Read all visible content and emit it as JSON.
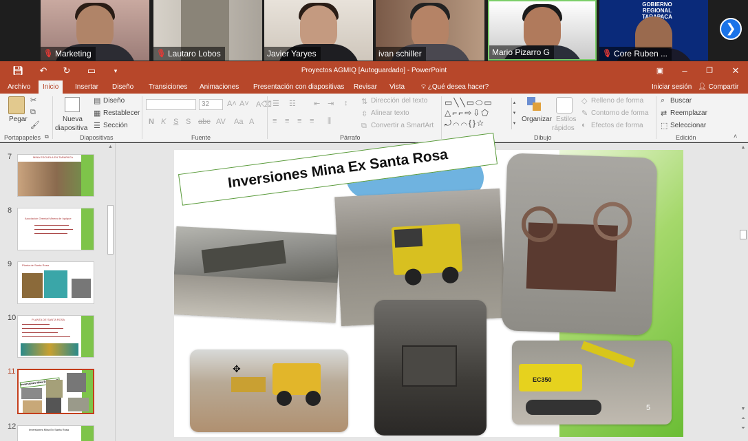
{
  "participants": [
    {
      "name": "Marketing",
      "muted": true
    },
    {
      "name": "Lautaro Lobos",
      "muted": true
    },
    {
      "name": "Javier Yaryes",
      "muted": false
    },
    {
      "name": "ivan schiller",
      "muted": false
    },
    {
      "name": "Mario Pizarro G",
      "muted": false
    },
    {
      "name": "Core Ruben ...",
      "muted": true
    }
  ],
  "gov_banner": "GOBIERNO REGIONAL\nTARAPACA",
  "window": {
    "title": "Proyectos AGMIQ [Autoguardado] - PowerPoint"
  },
  "tabs": [
    "Archivo",
    "Inicio",
    "Insertar",
    "Diseño",
    "Transiciones",
    "Animaciones",
    "Presentación con diapositivas",
    "Revisar",
    "Vista"
  ],
  "tell_me": "¿Qué desea hacer?",
  "signin": "Iniciar sesión",
  "share": "Compartir",
  "ribbon": {
    "clipboard": {
      "paste": "Pegar",
      "group": "Portapapeles"
    },
    "slides": {
      "new_line1": "Nueva",
      "new_line2": "diapositiva",
      "layout": "Diseño",
      "reset": "Restablecer",
      "section": "Sección",
      "group": "Diapositivas"
    },
    "font": {
      "size": "32",
      "group": "Fuente"
    },
    "paragraph": {
      "text_direction": "Dirección del texto",
      "align_text": "Alinear texto",
      "smartart": "Convertir a SmartArt",
      "group": "Párrafo"
    },
    "drawing": {
      "arrange": "Organizar",
      "styles_line1": "Estilos",
      "styles_line2": "rápidos",
      "fill": "Relleno de forma",
      "outline": "Contorno de forma",
      "effects": "Efectos de forma",
      "group": "Dibujo"
    },
    "editing": {
      "find": "Buscar",
      "replace": "Reemplazar",
      "select": "Seleccionar",
      "group": "Edición"
    }
  },
  "slides": [
    {
      "num": "7",
      "title": "MINA ESCUELA EN TARAPACA"
    },
    {
      "num": "8",
      "title": "Asociación Gremial Minera de Iquique"
    },
    {
      "num": "9",
      "title": "Planta de Santa Rosa"
    },
    {
      "num": "10",
      "title": "PLANTA DE SANTA ROSA"
    },
    {
      "num": "11",
      "title": "Inversiones Mina Ex Santa Rosa",
      "active": true
    },
    {
      "num": "12",
      "title": "Inversiones Mina Ex Santa Rosa"
    }
  ],
  "slide": {
    "title": "Inversiones Mina Ex Santa Rosa",
    "page_number": "5",
    "excavator_label": "EC350"
  },
  "colors": {
    "accent": "#b7472a",
    "ribbon_bg": "#f3f3f3",
    "banner_border": "#5a9b3b"
  }
}
